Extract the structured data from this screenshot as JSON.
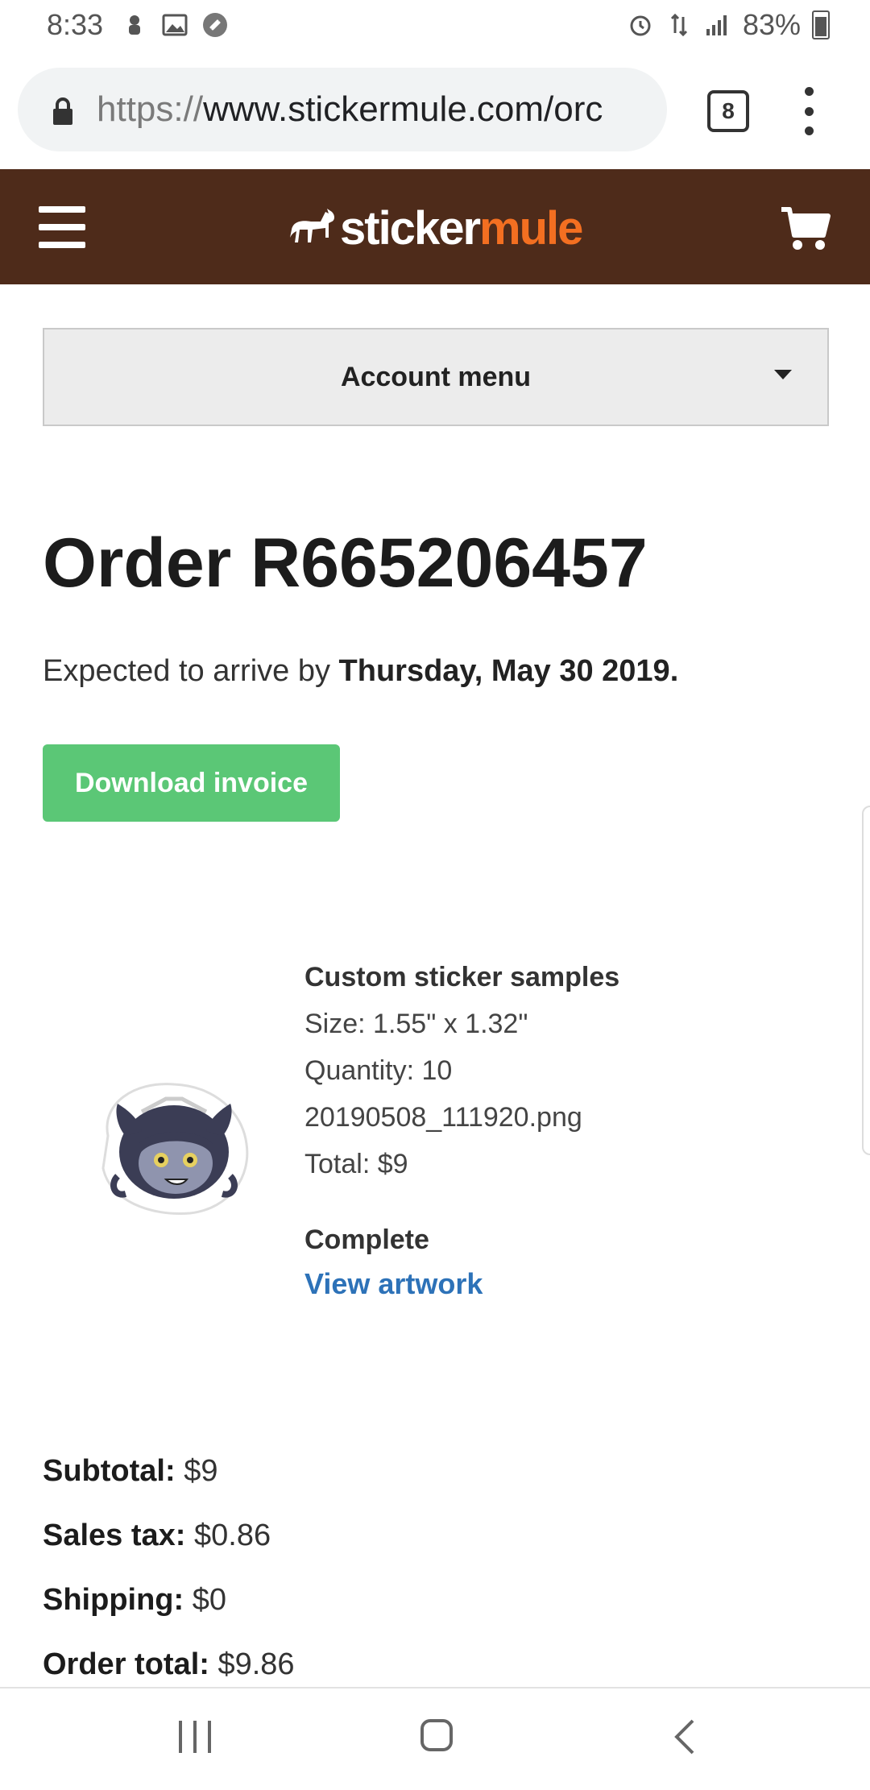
{
  "status_bar": {
    "time": "8:33",
    "battery": "83%",
    "left_icons": [
      "notification-icon",
      "gallery-icon",
      "shazam-icon"
    ],
    "right_icons": [
      "alarm-icon",
      "data-icon",
      "signal-icon",
      "battery-icon"
    ]
  },
  "browser": {
    "url_protocol": "https://",
    "url_rest": "www.stickermule.com/orc",
    "tab_count": "8"
  },
  "header": {
    "logo_part1": "sticker",
    "logo_part2": "mule",
    "brand_color": "#4e2b1a",
    "accent_color": "#f36f21"
  },
  "account_menu": {
    "label": "Account menu"
  },
  "order": {
    "title": "Order R665206457",
    "arrival_prefix": "Expected to arrive by ",
    "arrival_date": "Thursday, May 30 2019.",
    "download_label": "Download invoice"
  },
  "item": {
    "name": "Custom sticker samples",
    "size": "Size: 1.55\" x 1.32\"",
    "quantity": "Quantity: 10",
    "filename": "20190508_111920.png",
    "total": "Total: $9",
    "status": "Complete",
    "view_artwork": "View artwork"
  },
  "totals": {
    "subtotal_label": "Subtotal:",
    "subtotal_value": " $9",
    "tax_label": "Sales tax:",
    "tax_value": " $0.86",
    "shipping_label": "Shipping:",
    "shipping_value": " $0",
    "order_total_label": "Order total:",
    "order_total_value": " $9.86"
  }
}
